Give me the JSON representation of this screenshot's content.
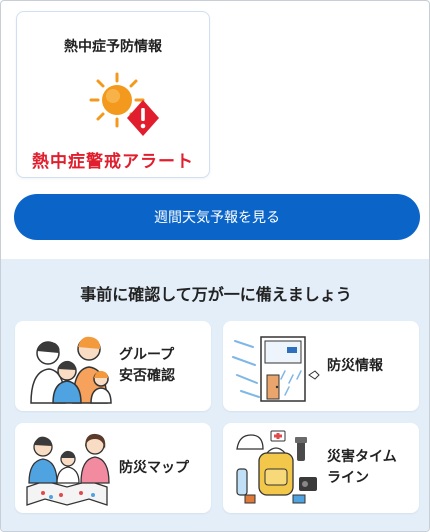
{
  "heat_card": {
    "title": "熱中症予防情報",
    "alert": "熱中症警戒アラート",
    "icon": "sun-warning-icon",
    "alert_color": "#e01e2d"
  },
  "forecast_button": {
    "label": "週間天気予報を見る",
    "color": "#0b64c8"
  },
  "preparedness": {
    "heading": "事前に確認して万が一に備えましょう",
    "background": "#e3eef9",
    "tiles": [
      {
        "label": "グループ\n安否確認",
        "icon": "family-group-icon"
      },
      {
        "label": "防災情報",
        "icon": "storm-house-icon"
      },
      {
        "label": "防災マップ",
        "icon": "family-map-icon"
      },
      {
        "label": "災害タイム\nライン",
        "icon": "emergency-supplies-icon"
      }
    ]
  }
}
